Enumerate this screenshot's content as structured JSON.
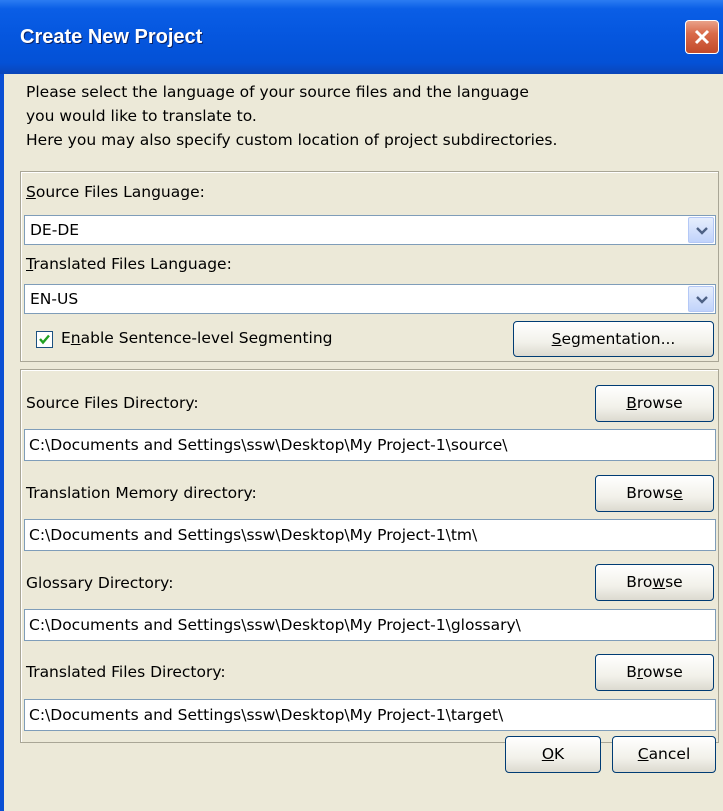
{
  "window": {
    "title": "Create New Project",
    "close_icon": "close-icon"
  },
  "intro": {
    "line1": "Please select the language of your source files and the language",
    "line2": "you would like to translate to.",
    "line3": "Here you may also specify custom location of project subdirectories."
  },
  "languages": {
    "source_label_key": "S",
    "source_label_rest": "ource Files Language:",
    "source_value": "DE-DE",
    "target_label_key": "T",
    "target_label_rest": "ranslated Files Language:",
    "target_value": "EN-US",
    "segmenting_checked": true,
    "segmenting_label_pre": "E",
    "segmenting_label_key": "n",
    "segmenting_label_rest": "able Sentence-level Segmenting",
    "segmentation_button_key": "S",
    "segmentation_button_rest": "egmentation..."
  },
  "directories": {
    "source": {
      "label": "Source Files Directory:",
      "value": "C:\\Documents and Settings\\ssw\\Desktop\\My Project-1\\source\\",
      "browse_key": "B",
      "browse_rest": "rowse"
    },
    "tm": {
      "label": "Translation Memory directory:",
      "value": "C:\\Documents and Settings\\ssw\\Desktop\\My Project-1\\tm\\",
      "browse_pre": "Brows",
      "browse_key": "e"
    },
    "glossary": {
      "label": "Glossary Directory:",
      "value": "C:\\Documents and Settings\\ssw\\Desktop\\My Project-1\\glossary\\",
      "browse_pre": "Bro",
      "browse_key": "w",
      "browse_rest": "se"
    },
    "target": {
      "label": "Translated Files Directory:",
      "value": "C:\\Documents and Settings\\ssw\\Desktop\\My Project-1\\target\\",
      "browse_pre": "B",
      "browse_key": "r",
      "browse_rest": "owse"
    }
  },
  "footer": {
    "ok_key": "O",
    "ok_rest": "K",
    "cancel_key": "C",
    "cancel_rest": "ancel"
  }
}
